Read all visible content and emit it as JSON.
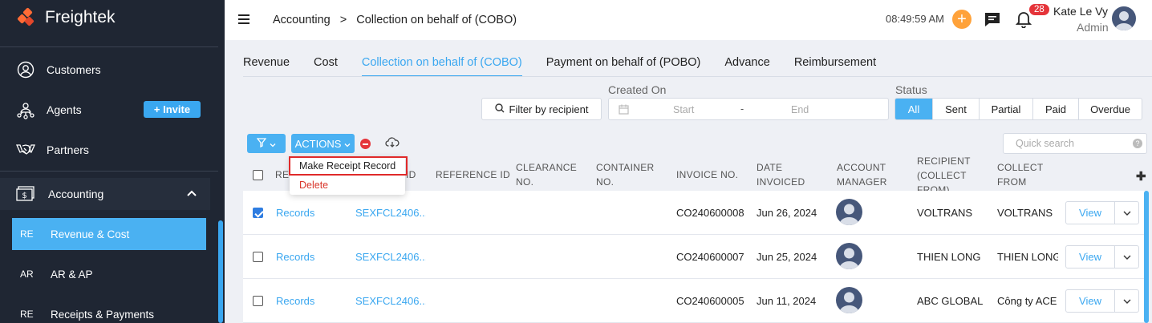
{
  "brand": {
    "name": "Freightek"
  },
  "sidebar": {
    "items": [
      {
        "label": "Customers"
      },
      {
        "label": "Agents",
        "invite_label": "+ Invite"
      },
      {
        "label": "Partners"
      },
      {
        "label": "Accounting"
      }
    ],
    "sub_items": [
      {
        "abbr": "RE",
        "label": "Revenue & Cost",
        "active": true
      },
      {
        "abbr": "AR",
        "label": "AR & AP"
      },
      {
        "abbr": "RE",
        "label": "Receipts & Payments"
      }
    ]
  },
  "header": {
    "breadcrumb": [
      "Accounting",
      ">",
      "Collection on behalf of (COBO)"
    ],
    "clock": "08:49:59 AM",
    "notifications": "28",
    "user_name": "Kate Le Vy",
    "user_role": "Admin"
  },
  "tabs": [
    {
      "label": "Revenue"
    },
    {
      "label": "Cost"
    },
    {
      "label": "Collection on behalf of (COBO)",
      "active": true
    },
    {
      "label": "Payment on behalf of (POBO)"
    },
    {
      "label": "Advance"
    },
    {
      "label": "Reimbursement"
    }
  ],
  "filters": {
    "created_on_label": "Created On",
    "status_label": "Status",
    "recipient_filter": "Filter by recipient",
    "start_placeholder": "Start",
    "date_separator": "-",
    "end_placeholder": "End",
    "status_options": [
      "All",
      "Sent",
      "Partial",
      "Paid",
      "Overdue"
    ],
    "status_selected": "All",
    "quick_search_placeholder": "Quick search",
    "quick_search_help": "?"
  },
  "toolbar": {
    "actions_label": "ACTIONS"
  },
  "actions_menu": [
    {
      "label": "Make Receipt Record",
      "color": "#222222"
    },
    {
      "label": "Delete",
      "color": "#d9362b"
    }
  ],
  "table": {
    "headers": {
      "record": "RE",
      "job_id": "ID",
      "reference_id": "REFERENCE ID",
      "clearance_no": [
        "CLEARANCE",
        "NO."
      ],
      "container_no": [
        "CONTAINER",
        "NO."
      ],
      "invoice_no": "INVOICE NO.",
      "date_invoiced": [
        "DATE",
        "INVOICED"
      ],
      "account_manager": [
        "ACCOUNT",
        "MANAGER"
      ],
      "recipient": [
        "RECIPIENT",
        "(COLLECT",
        "FROM)"
      ],
      "collect_from": [
        "COLLECT",
        "FROM"
      ]
    },
    "rows": [
      {
        "checked": true,
        "record": "Records",
        "job_id": "SEXFCL2406...",
        "invoice_no": "CO240600008",
        "date_invoiced": "Jun 26, 2024",
        "recipient": "VOLTRANS",
        "collect_from": "VOLTRANS",
        "view": "View"
      },
      {
        "checked": false,
        "record": "Records",
        "job_id": "SEXFCL2406...",
        "invoice_no": "CO240600007",
        "date_invoiced": "Jun 25, 2024",
        "recipient": "THIEN LONG",
        "collect_from": "THIEN LONG",
        "view": "View"
      },
      {
        "checked": false,
        "record": "Records",
        "job_id": "SEXFCL2406...",
        "invoice_no": "CO240600005",
        "date_invoiced": "Jun 11, 2024",
        "recipient": "ABC GLOBAL",
        "collect_from": "Công ty ACE",
        "view": "View"
      }
    ]
  },
  "colors": {
    "accent": "#4ab1f2",
    "sidebar_bg": "#1f2633",
    "danger": "#e5343a",
    "highlight_border": "#e02a2a"
  }
}
